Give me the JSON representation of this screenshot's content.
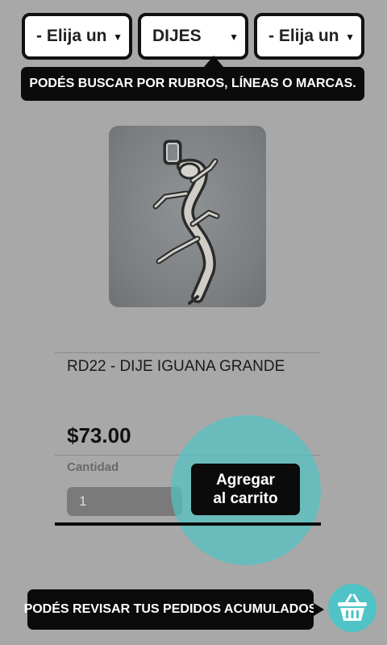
{
  "filters": {
    "rubro": {
      "selected": "- Elija un"
    },
    "linea": {
      "selected": "DIJES"
    },
    "marca": {
      "selected": "- Elija un"
    }
  },
  "hints": {
    "search": "PODÉS BUSCAR POR RUBROS, LÍNEAS O MARCAS.",
    "orders": "PODÉS REVISAR TUS PEDIDOS ACUMULADOS"
  },
  "product": {
    "title": "RD22 - DIJE IGUANA GRANDE",
    "price": "$73.00",
    "quantity_label": "Cantidad",
    "quantity_value": "1"
  },
  "actions": {
    "add_to_cart_line1": "Agregar",
    "add_to_cart_line2": "al carrito"
  },
  "icons": {
    "dropdown": "chevron-down-icon",
    "cart": "basket-icon",
    "product": "iguana-pendant-image"
  },
  "colors": {
    "background": "#a8a8a8",
    "accent": "#4fc3c5",
    "tooltip": "#0b0b0b"
  }
}
